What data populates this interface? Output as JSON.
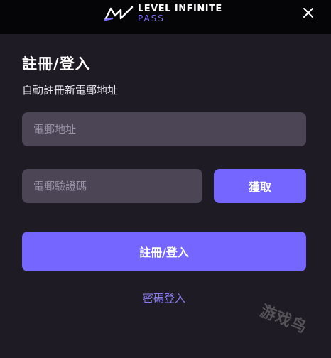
{
  "header": {
    "logo_line1": "LEVEL INFINITE",
    "logo_line2": "PASS",
    "close_icon": "close-icon"
  },
  "form": {
    "title": "註冊/登入",
    "subtitle": "自動註冊新電郵地址",
    "email_placeholder": "電郵地址",
    "code_placeholder": "電郵驗證碼",
    "get_code_label": "獲取",
    "submit_label": "註冊/登入",
    "password_login_link": "密碼登入"
  },
  "watermark": "游戏鸟",
  "colors": {
    "background": "#1f1b24",
    "topbar": "#050407",
    "input": "#4b4556",
    "accent": "#7466ff",
    "link": "#8b7ef2"
  }
}
